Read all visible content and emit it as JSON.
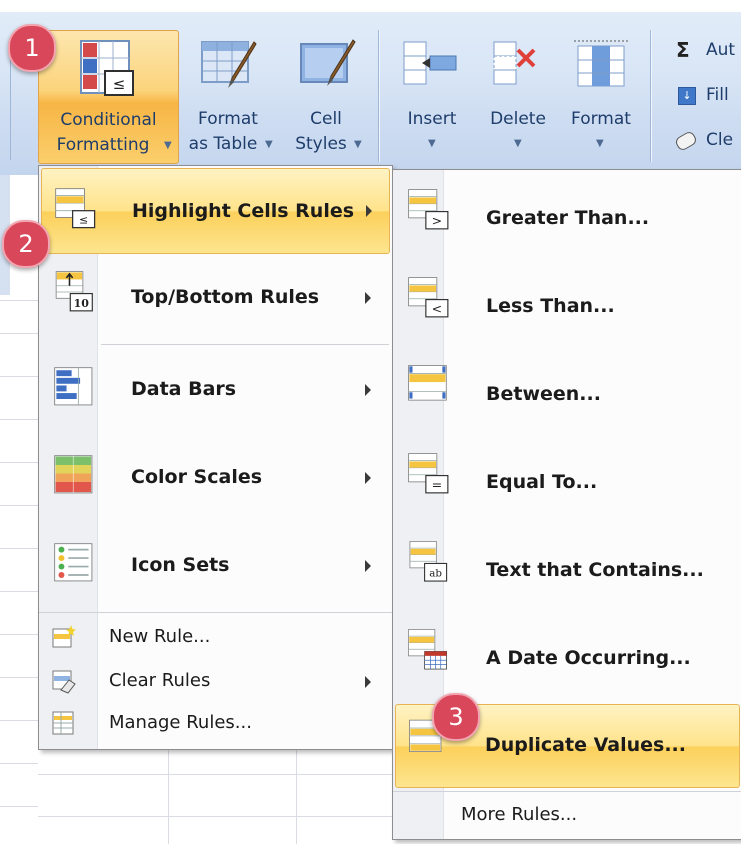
{
  "ribbon": {
    "conditional_formatting": {
      "line1": "Conditional",
      "line2": "Formatting"
    },
    "format_as_table": {
      "line1": "Format",
      "line2": "as Table"
    },
    "cell_styles": {
      "line1": "Cell",
      "line2": "Styles"
    },
    "insert": "Insert",
    "delete": "Delete",
    "format": "Format",
    "editing": {
      "autosum": "Aut",
      "fill": "Fill",
      "clear": "Cle"
    }
  },
  "menu1": {
    "items": [
      {
        "label": "Highlight Cells Rules",
        "icon": "highlight-cells-icon",
        "submenu": true
      },
      {
        "label": "Top/Bottom Rules",
        "icon": "top-bottom-icon",
        "submenu": true
      },
      {
        "label": "Data Bars",
        "icon": "data-bars-icon",
        "submenu": true
      },
      {
        "label": "Color Scales",
        "icon": "color-scales-icon",
        "submenu": true
      },
      {
        "label": "Icon Sets",
        "icon": "icon-sets-icon",
        "submenu": true
      }
    ],
    "small_items": [
      {
        "label": "New Rule...",
        "icon": "new-rule-icon"
      },
      {
        "label": "Clear Rules",
        "icon": "clear-rules-icon",
        "submenu": true
      },
      {
        "label": "Manage Rules...",
        "icon": "manage-rules-icon"
      }
    ]
  },
  "menu2": {
    "items": [
      {
        "label": "Greater Than...",
        "icon": "greater-than-icon",
        "glyph": ">"
      },
      {
        "label": "Less Than...",
        "icon": "less-than-icon",
        "glyph": "<"
      },
      {
        "label": "Between...",
        "icon": "between-icon"
      },
      {
        "label": "Equal To...",
        "icon": "equal-to-icon",
        "glyph": "="
      },
      {
        "label": "Text that Contains...",
        "icon": "text-contains-icon",
        "glyph": "ab"
      },
      {
        "label": "A Date Occurring...",
        "icon": "date-occurring-icon"
      },
      {
        "label": "Duplicate Values...",
        "icon": "duplicate-values-icon"
      }
    ],
    "more_rules": "More Rules..."
  },
  "badges": [
    "1",
    "2",
    "3"
  ],
  "colors": {
    "highlight": "#fcd05b",
    "badge": "#d9475a",
    "ribbon": "#d9e6f6"
  }
}
